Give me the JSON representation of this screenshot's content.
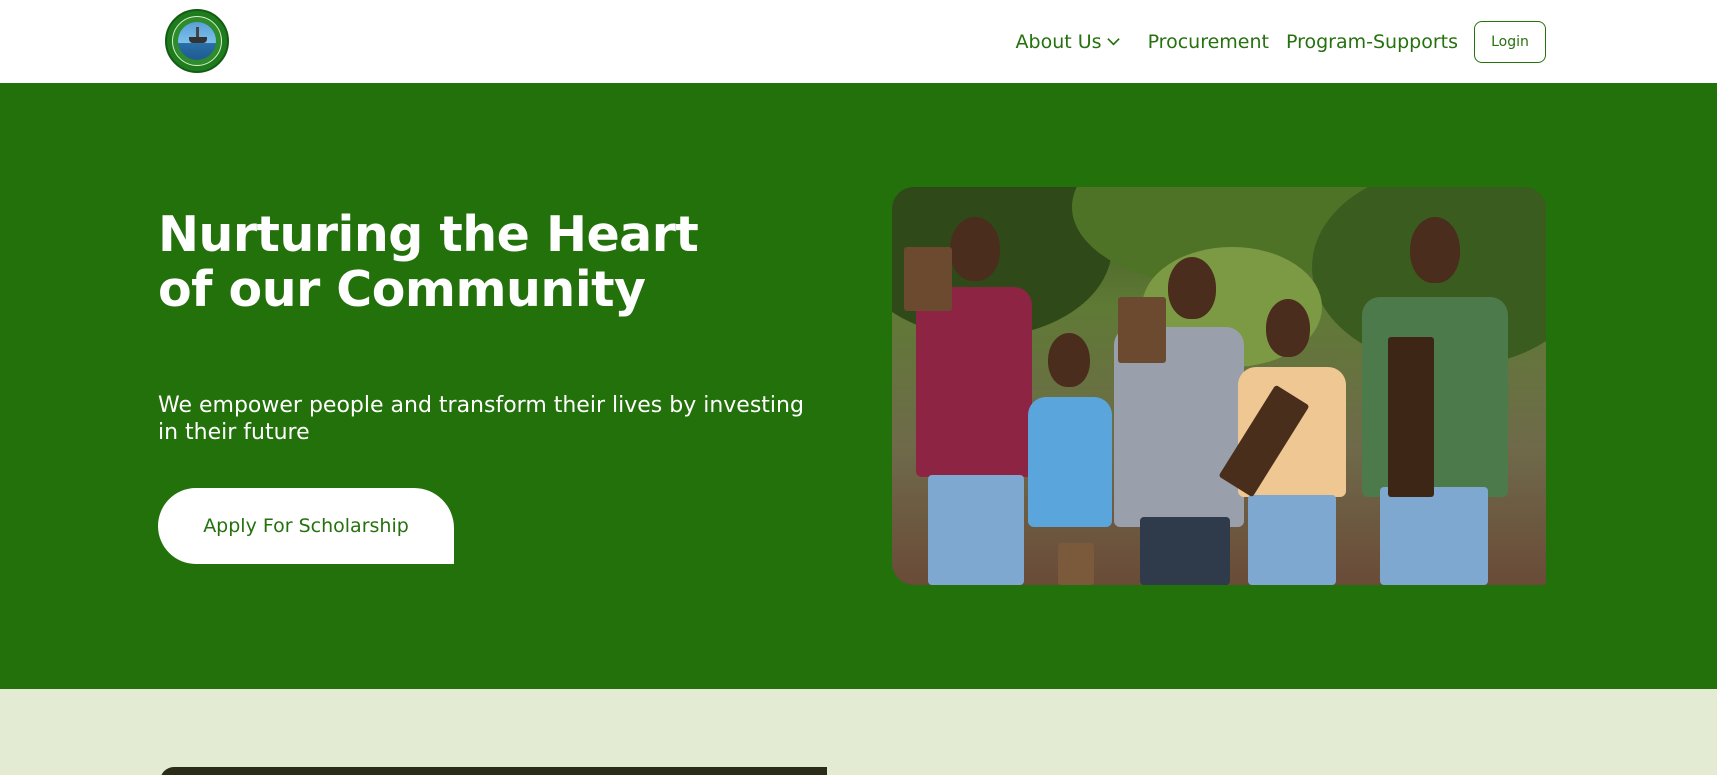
{
  "nav": {
    "about": "About Us",
    "procurement": "Procurement",
    "program_supports": "Program-Supports",
    "login": "Login"
  },
  "hero": {
    "title": "Nurturing the Heart of our Community",
    "subtitle": "We empower people and transform their lives by investing in their future",
    "cta": "Apply For Scholarship"
  },
  "colors": {
    "brand_green": "#22710b",
    "nav_text": "#25710e",
    "lower_section_bg": "#e3ebd3"
  },
  "icons": {
    "about_dropdown": "chevron-down-icon",
    "logo": "community-trust-logo"
  }
}
